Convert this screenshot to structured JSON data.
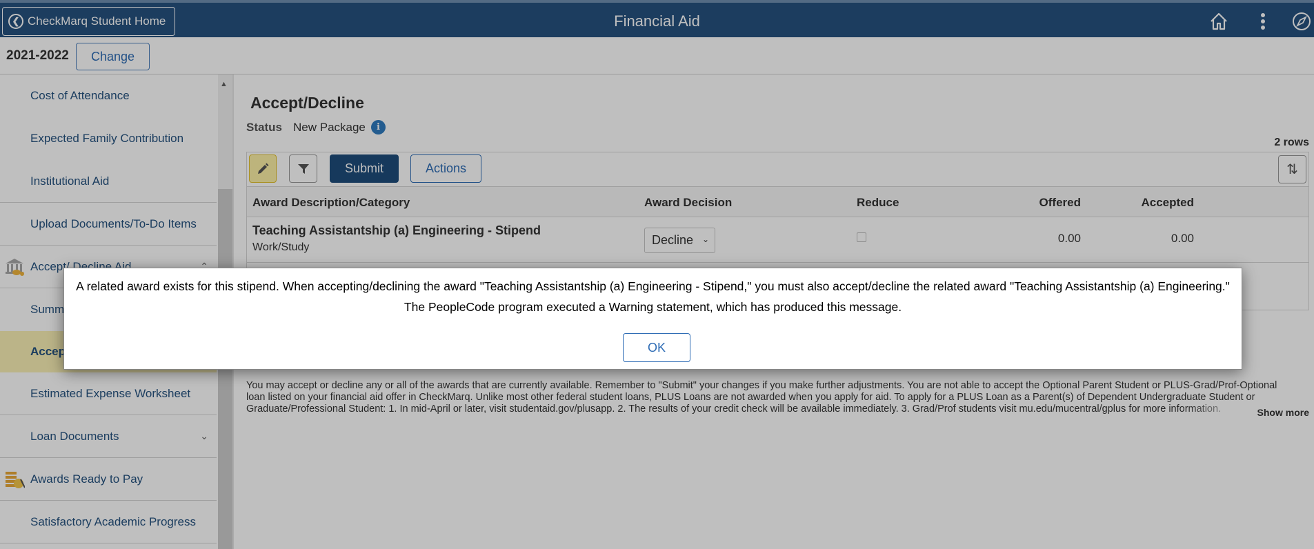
{
  "header": {
    "back_label": "CheckMarq Student Home",
    "title": "Financial Aid",
    "icons": [
      "home-icon",
      "more-vertical-icon",
      "compass-icon"
    ]
  },
  "subbar": {
    "aid_year": "2021-2022",
    "change_label": "Change"
  },
  "sidebar": {
    "items": [
      {
        "label": "Cost of Attendance",
        "active": false
      },
      {
        "label": "Expected Family Contribution",
        "active": false
      },
      {
        "label": "Institutional Aid",
        "active": false
      },
      {
        "label": "Upload Documents/To-Do Items",
        "active": false
      },
      {
        "label": "Accept/ Decline Aid",
        "active": false,
        "icon": "bank-coins-icon",
        "expander": "chevron-up-icon"
      },
      {
        "label": "Summary",
        "active": false
      },
      {
        "label": "Accept/Decline",
        "active": true
      },
      {
        "label": "Estimated Expense Worksheet",
        "active": false
      },
      {
        "label": "Loan Documents",
        "active": false,
        "expander": "chevron-down-icon"
      },
      {
        "label": "Awards Ready to Pay",
        "active": false,
        "icon": "coins-icon"
      },
      {
        "label": "Satisfactory Academic Progress",
        "active": false
      }
    ]
  },
  "main": {
    "title": "Accept/Decline",
    "status_label": "Status",
    "status_value": "New Package",
    "rows_count": "2 rows",
    "toolbar": {
      "submit_label": "Submit",
      "actions_label": "Actions"
    },
    "columns": [
      "Award Description/Category",
      "Award Decision",
      "Reduce",
      "Offered",
      "Accepted"
    ],
    "rows": [
      {
        "description": "Teaching Assistantship (a) Engineering - Stipend",
        "category": "Work/Study",
        "decision": "Decline",
        "reduce": false,
        "offered": "0.00",
        "accepted": "0.00"
      }
    ],
    "instructions": "You may accept or decline any or all of the awards that are currently available. Remember to \"Submit\" your changes if you make further adjustments. You are not able to accept the Optional Parent Student or PLUS-Grad/Prof-Optional loan listed on your financial aid offer in CheckMarq. Unlike most other federal student loans, PLUS Loans are not awarded when you apply for aid. To apply for a PLUS Loan as a Parent(s) of Dependent Undergraduate Student or Graduate/Professional Student: 1. In mid-April or later, visit studentaid.gov/plusapp. 2. The results of your credit check will be available immediately. 3. Grad/Prof students visit mu.edu/mucentral/gplus for more information.",
    "show_more_label": "Show more"
  },
  "modal": {
    "message": "A related award exists for this stipend.  When accepting/declining the award \"Teaching Assistantship (a) Engineering - Stipend,\" you must also accept/decline the related award \"Teaching Assistantship (a) Engineering.\"",
    "sub_message": "The PeopleCode program executed a Warning statement, which has produced this message.",
    "ok_label": "OK"
  }
}
